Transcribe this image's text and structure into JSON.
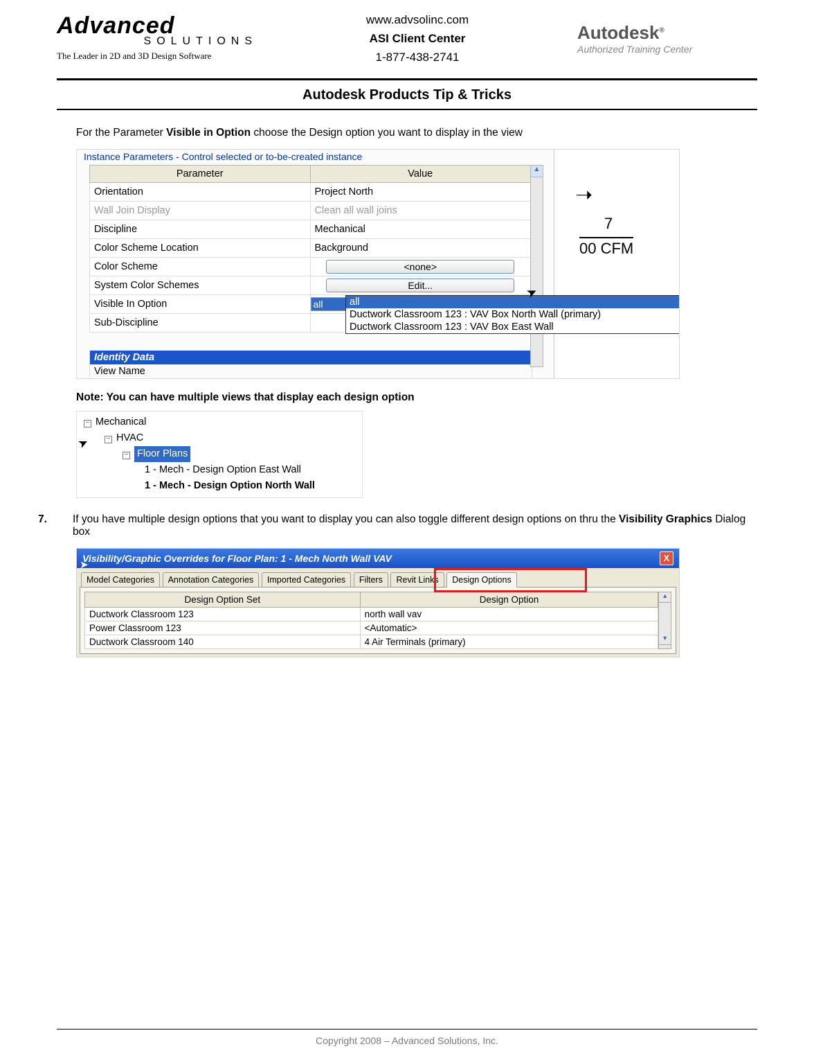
{
  "header": {
    "brand_top": "Advanced",
    "brand_sub": "SOLUTIONS",
    "brand_tag": "The Leader in 2D and 3D Design Software",
    "url": "www.advsolinc.com",
    "center_title": "ASI Client Center",
    "phone": "1-877-438-2741",
    "autodesk": "Autodesk",
    "autodesk_sub": "Authorized Training Center"
  },
  "doc_title": "Autodesk Products Tip & Tricks",
  "intro_pre": "For the Parameter ",
  "intro_bold": "Visible in Option",
  "intro_post": " choose the Design option you want to display in the view",
  "panel1": {
    "legend": "Instance Parameters - Control selected or to-be-created instance",
    "col_param": "Parameter",
    "col_value": "Value",
    "rows": {
      "orientation": {
        "p": "Orientation",
        "v": "Project North"
      },
      "wall": {
        "p": "Wall Join Display",
        "v": "Clean all wall joins"
      },
      "disc": {
        "p": "Discipline",
        "v": "Mechanical"
      },
      "csl": {
        "p": "Color Scheme Location",
        "v": "Background"
      },
      "cs": {
        "p": "Color Scheme",
        "v": "<none>"
      },
      "scs": {
        "p": "System Color Schemes",
        "v": "Edit..."
      },
      "vio": {
        "p": "Visible In Option",
        "v": "all"
      },
      "sub": {
        "p": "Sub-Discipline",
        "v": ""
      }
    },
    "dropdown": {
      "opt0": "all",
      "opt1": "Ductwork Classroom 123 : VAV Box North Wall (primary)",
      "opt2": "Ductwork Classroom 123 : VAV Box East Wall"
    },
    "identity_header": "Identity Data",
    "view_name": "View Name",
    "side_num": "7",
    "side_cfm": "00 CFM"
  },
  "note": "Note: You can have multiple views that display each design option",
  "tree": {
    "mech": "Mechanical",
    "hvac": "HVAC",
    "fp": "Floor Plans",
    "item1": "1 - Mech - Design Option East Wall",
    "item2": "1 - Mech - Design Option North Wall"
  },
  "step": {
    "num": "7.",
    "pre": "If you have multiple design options that you want to display you can also toggle different design options on thru the ",
    "bold": "Visibility Graphics",
    "post": " Dialog box"
  },
  "panel2": {
    "title": "Visibility/Graphic Overrides for Floor Plan: 1 - Mech North Wall VAV",
    "close": "X",
    "tabs": {
      "t1": "Model Categories",
      "t2": "Annotation Categories",
      "t3": "Imported Categories",
      "t4": "Filters",
      "t5": "Revit Links",
      "t6": "Design Options"
    },
    "col_set": "Design Option Set",
    "col_opt": "Design Option",
    "rows": {
      "r1": {
        "s": "Ductwork Classroom 123",
        "o": "north wall vav"
      },
      "r2": {
        "s": "Power Classroom 123",
        "o": "<Automatic>"
      },
      "r3": {
        "s": "Ductwork Classroom 140",
        "o": "4 Air Terminals (primary)"
      }
    }
  },
  "footer": "Copyright 2008 – Advanced Solutions, Inc."
}
